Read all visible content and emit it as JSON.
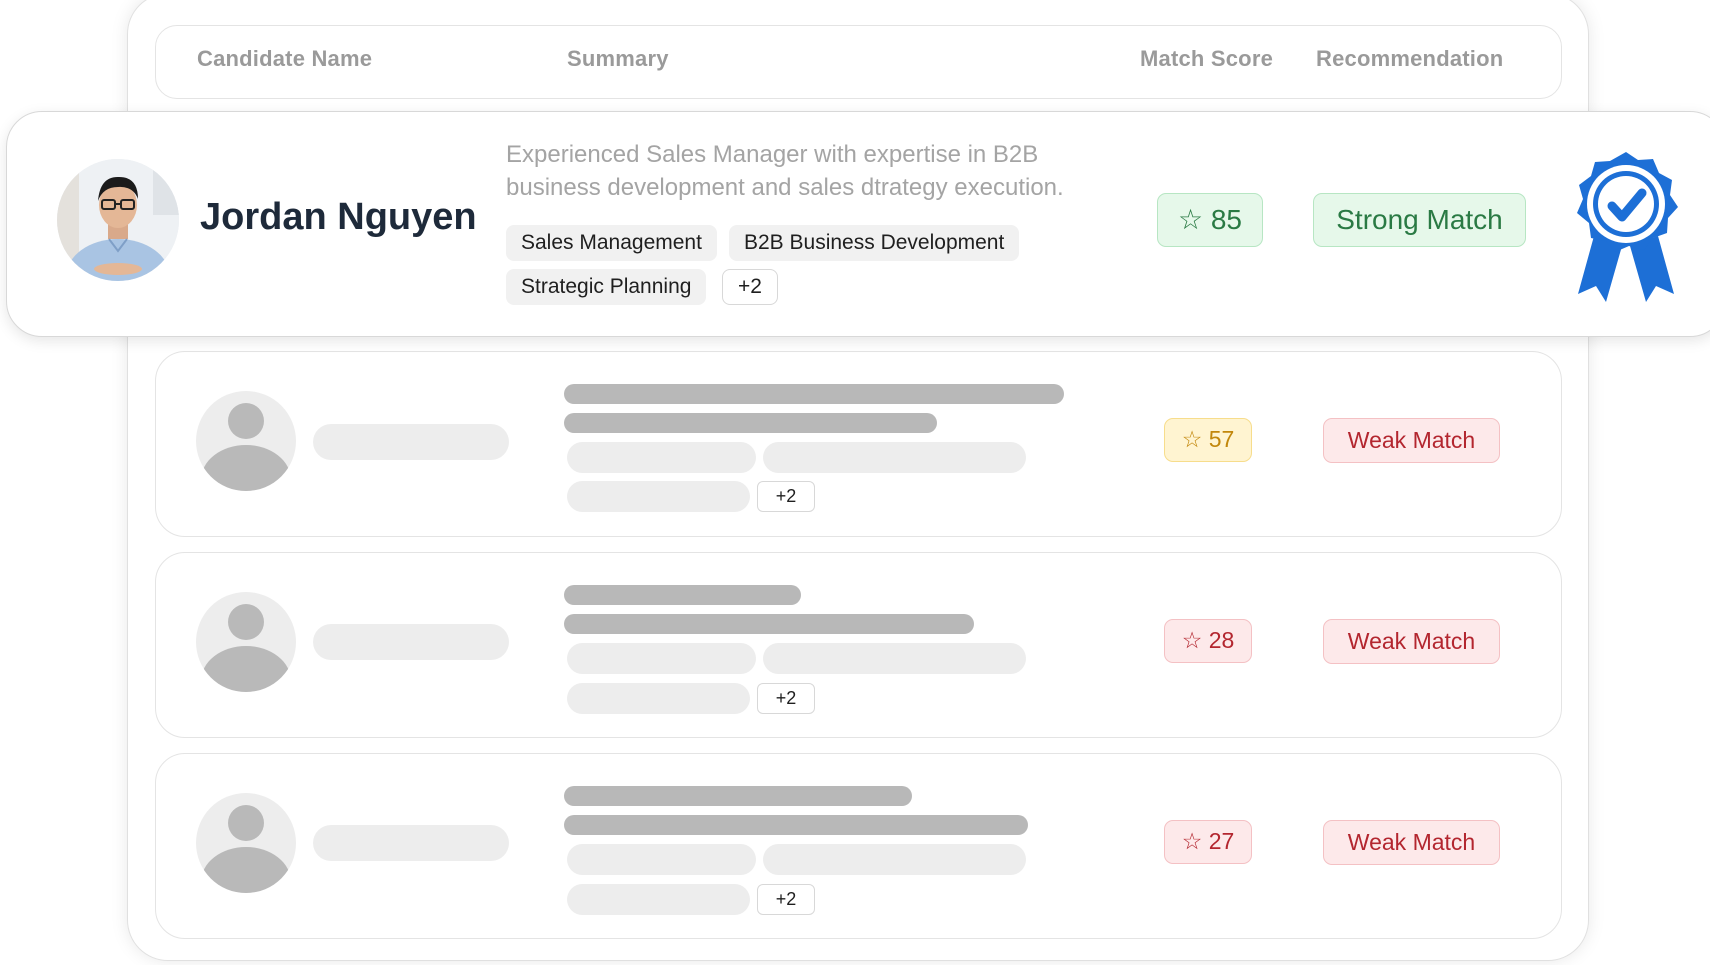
{
  "table": {
    "headers": {
      "name": "Candidate Name",
      "summary": "Summary",
      "score": "Match Score",
      "recommendation": "Recommendation"
    }
  },
  "featured": {
    "name": "Jordan Nguyen",
    "summary": "Experienced Sales Manager with expertise in B2B business development and sales dtrategy execution.",
    "tags": [
      "Sales Management",
      "B2B Business Development",
      "Strategic Planning",
      "+2"
    ],
    "score": "85",
    "recommendation": "Strong Match",
    "badge_icon": "award-ribbon-check-icon"
  },
  "rows": [
    {
      "score": "57",
      "recommendation": "Weak Match",
      "more": "+2",
      "score_color": "#c2870c"
    },
    {
      "score": "28",
      "recommendation": "Weak Match",
      "more": "+2",
      "score_color": "#b3262f"
    },
    {
      "score": "27",
      "recommendation": "Weak Match",
      "more": "+2",
      "score_color": "#b3262f"
    }
  ],
  "colors": {
    "accent_blue": "#1d6fd6",
    "strong_green": "#2a7a44",
    "weak_red": "#b3262f",
    "mid_yellow": "#c2870c"
  }
}
